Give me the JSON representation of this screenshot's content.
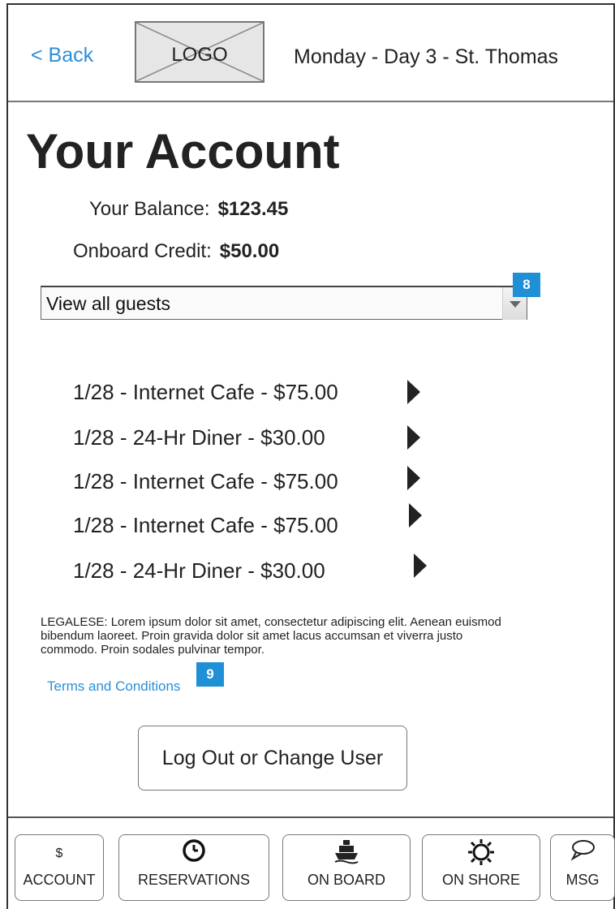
{
  "header": {
    "back_label": "< Back",
    "logo_label": "LOGO",
    "day_title": "Monday - Day 3 - St. Thomas"
  },
  "account": {
    "title": "Your Account",
    "balance_label": "Your Balance:",
    "balance_value": "$123.45",
    "credit_label": "Onboard Credit:",
    "credit_value": "$50.00"
  },
  "guest_filter": {
    "selected": "View all guests",
    "annotation": "8"
  },
  "transactions": [
    {
      "text": "1/28  -  Internet Cafe  -  $75.00"
    },
    {
      "text": "1/28  -  24-Hr Diner  -  $30.00"
    },
    {
      "text": "1/28  -  Internet Cafe  -  $75.00"
    },
    {
      "text": "1/28  -  Internet Cafe  -  $75.00"
    },
    {
      "text": "1/28  -  24-Hr Diner  -  $30.00"
    }
  ],
  "legal": {
    "text": "LEGALESE: Lorem ipsum dolor sit amet, consectetur adipiscing elit. Aenean euismod bibendum laoreet. Proin gravida dolor sit amet lacus accumsan et viverra justo commodo. Proin sodales pulvinar tempor.",
    "terms_label": "Terms and Conditions",
    "annotation": "9"
  },
  "logout_label": "Log Out or Change User",
  "nav": {
    "account_symbol": "$",
    "account": "ACCOUNT",
    "reservations": "RESERVATIONS",
    "on_board": "ON BOARD",
    "on_shore": "ON SHORE",
    "msg": "MSG"
  },
  "colors": {
    "link": "#2b8fd6",
    "badge": "#1f8fd6",
    "text": "#222222"
  },
  "icons": {
    "reservations": "clock-icon",
    "on_board": "ship-icon",
    "on_shore": "sun-icon",
    "msg": "speech-bubble-icon"
  }
}
